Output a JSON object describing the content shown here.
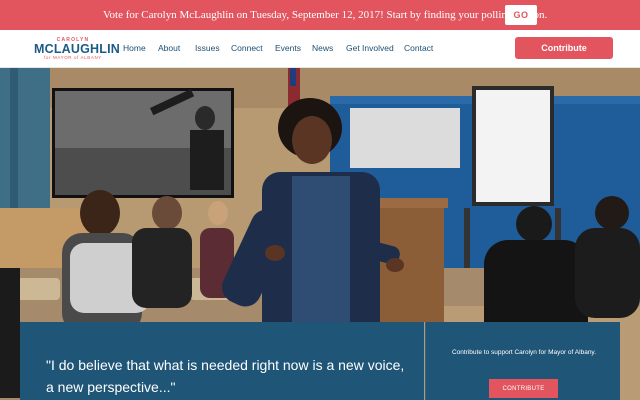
{
  "alert": {
    "message": "Vote for Carolyn McLaughlin on Tuesday, September 12, 2017! Start by finding your polling station.",
    "go_label": "GO"
  },
  "logo": {
    "first_name": "CAROLYN",
    "last_name": "MCLAUGHLIN",
    "subtitle": "for MAYOR of ALBANY"
  },
  "nav": {
    "items": [
      "Home",
      "About",
      "Issues",
      "Connect",
      "Events",
      "News",
      "Get Involved",
      "Contact"
    ],
    "contribute_label": "Contribute"
  },
  "hero": {
    "photo": "town-hall-meeting-photo"
  },
  "quote": {
    "text": "\"I do believe that what is needed right now is a new voice, a new perspective...\""
  },
  "donate": {
    "text": "Contribute to support Carolyn for Mayor of Albany.",
    "button_label": "CONTRIBUTE"
  },
  "colors": {
    "accent": "#e2555f",
    "brand_blue": "#1c5a87",
    "panel": "#1f5577"
  }
}
